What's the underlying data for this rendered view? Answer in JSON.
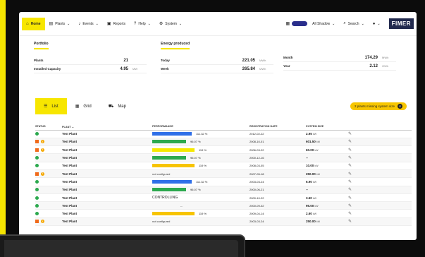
{
  "nav": {
    "home": "Home",
    "plants": "Plants",
    "events": "Events",
    "reports": "Reports",
    "help": "Help",
    "system": "System",
    "all_shadow": "All Shadow",
    "search": "Search",
    "logo": "FIMER"
  },
  "portfolio": {
    "title": "Portfolio",
    "rows": [
      {
        "k": "Plants",
        "v": "21",
        "u": ""
      },
      {
        "k": "Installed Capacity",
        "v": "4.95",
        "u": "MW"
      }
    ]
  },
  "energy": {
    "title": "Energy produced",
    "left": [
      {
        "k": "Today",
        "v": "221.05",
        "u": "MWh"
      },
      {
        "k": "Week",
        "v": "265.84",
        "u": "MWh"
      }
    ],
    "right": [
      {
        "k": "Month",
        "v": "174.29",
        "u": "MWh"
      },
      {
        "k": "Year",
        "v": "2.12",
        "u": "GWh"
      }
    ]
  },
  "tabs": {
    "list": "List",
    "grid": "Grid",
    "map": "Map"
  },
  "badge": "2 plants missing system size",
  "table": {
    "headers": [
      "STATUS",
      "PLANT",
      "PERFORMANCE",
      "REGISTRATION DATE",
      "SYSTEM SIZE"
    ],
    "rows": [
      {
        "status": "ok",
        "plant": "Test Plant",
        "perf": "111.32 %",
        "perf_value": 111.32,
        "bar": "#2f6fe8",
        "date": "2012-02-22",
        "size": "2.95",
        "unit": "kW"
      },
      {
        "status": "warn",
        "plant": "Test Plant",
        "perf": "96.07 %",
        "perf_value": 96.07,
        "bar": "#2ca94e",
        "date": "2008-10-01",
        "size": "601.50",
        "unit": "kW"
      },
      {
        "status": "warn",
        "plant": "Test Plant",
        "perf": "119 %",
        "perf_value": 119,
        "bar": "#f5e800",
        "date": "2006-03-22",
        "size": "60.00",
        "unit": "kW"
      },
      {
        "status": "ok",
        "plant": "Test Plant",
        "perf": "96.07 %",
        "perf_value": 96.07,
        "bar": "#2ca94e",
        "date": "2000-12-16",
        "size": "--",
        "unit": ""
      },
      {
        "status": "ok",
        "plant": "Test Plant",
        "perf": "119 %",
        "perf_value": 119,
        "bar": "#f7c400",
        "date": "2008-03-05",
        "size": "10.00",
        "unit": "kW"
      },
      {
        "status": "warn",
        "plant": "Test Plant",
        "perf": "not configured",
        "perf_value": null,
        "bar": "",
        "date": "2007-05-18",
        "size": "250.00",
        "unit": "kW"
      },
      {
        "status": "ok",
        "plant": "Test Plant",
        "perf": "111.32 %",
        "perf_value": 111.32,
        "bar": "#2f6fe8",
        "date": "2003-03-24",
        "size": "6.90",
        "unit": "kW"
      },
      {
        "status": "ok",
        "plant": "Test Plant",
        "perf": "96.07 %",
        "perf_value": 96.07,
        "bar": "#2ca94e",
        "date": "2000-06-21",
        "size": "--",
        "unit": ""
      },
      {
        "status": "ok",
        "plant": "Test Plant",
        "perf": "CONTROLLING",
        "perf_value": null,
        "bar": "",
        "date": "2000-10-22",
        "size": "3.60",
        "unit": "kW"
      },
      {
        "status": "ok",
        "plant": "Test Plant",
        "perf": "--",
        "perf_value": null,
        "bar": "",
        "date": "2000-09-02",
        "size": "95.00",
        "unit": "kW"
      },
      {
        "status": "ok",
        "plant": "Test Plant",
        "perf": "119 %",
        "perf_value": 119,
        "bar": "#f7c400",
        "date": "2009-04-14",
        "size": "2.60",
        "unit": "kW"
      },
      {
        "status": "warn",
        "plant": "Test Plant",
        "perf": "not configured",
        "perf_value": null,
        "bar": "",
        "date": "2003-03-24",
        "size": "250.00",
        "unit": "kW"
      }
    ]
  },
  "colors": {
    "accent": "#f7e600",
    "brand": "#222a4e",
    "ok": "#2ca94e",
    "warn": "#f5a800",
    "alert": "#f06a1a"
  }
}
